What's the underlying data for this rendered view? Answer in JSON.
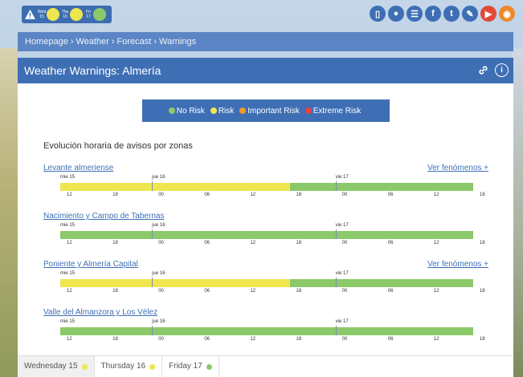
{
  "colors": {
    "no_risk": "#8cc96a",
    "risk": "#efe64f",
    "important_risk": "#f19a2b",
    "extreme_risk": "#e94040",
    "header_blue": "#3e6fb5",
    "breadcrumb_blue": "#5b85c4",
    "link": "#3e6fb5"
  },
  "forecast_mini": {
    "days": [
      {
        "label": "Wed 15",
        "line1": "Wed",
        "line2": "15",
        "level": "risk"
      },
      {
        "label": "Thu 16",
        "line1": "Thu",
        "line2": "16",
        "level": "risk"
      },
      {
        "label": "Fri 17",
        "line1": "Fri",
        "line2": "17",
        "level": "no_risk"
      }
    ]
  },
  "social_icons": [
    {
      "name": "mobile-icon",
      "glyph": "▯",
      "color": "#3e6fb5"
    },
    {
      "name": "android-icon",
      "glyph": "●",
      "color": "#3e6fb5"
    },
    {
      "name": "list-icon",
      "glyph": "☰",
      "color": "#3e6fb5"
    },
    {
      "name": "facebook-icon",
      "glyph": "f",
      "color": "#3e6fb5"
    },
    {
      "name": "twitter-icon",
      "glyph": "t",
      "color": "#3e6fb5"
    },
    {
      "name": "edit-icon",
      "glyph": "✎",
      "color": "#3e6fb5"
    },
    {
      "name": "youtube-icon",
      "glyph": "▶",
      "color": "#e04a3a"
    },
    {
      "name": "rss-icon",
      "glyph": "◉",
      "color": "#ec8a2a"
    }
  ],
  "breadcrumb": {
    "items": [
      "Homepage",
      "Weather",
      "Forecast",
      "Warnings"
    ],
    "separator": "›"
  },
  "panel": {
    "title": "Weather Warnings: Almería"
  },
  "legend": [
    {
      "label": "No Risk",
      "level": "no_risk"
    },
    {
      "label": "Risk",
      "level": "risk"
    },
    {
      "label": "Important Risk",
      "level": "important_risk"
    },
    {
      "label": "Extreme Risk",
      "level": "extreme_risk"
    }
  ],
  "section_title": "Evolución horaria de avisos por zonas",
  "timeline": {
    "day_labels": [
      "mie 15",
      "jue 16",
      "vie 17"
    ],
    "hour_labels": [
      "12",
      "18",
      "00",
      "06",
      "12",
      "18",
      "00",
      "06",
      "12",
      "18"
    ],
    "total_hours": 54
  },
  "zones": [
    {
      "name": "Levante almeriense",
      "link_label": "Ver fenómenos +",
      "segments": [
        {
          "from_hour": 0,
          "to_hour": 30,
          "level": "risk"
        },
        {
          "from_hour": 30,
          "to_hour": 54,
          "level": "no_risk"
        }
      ]
    },
    {
      "name": "Nacimiento y Campo de Tabernas",
      "link_label": "",
      "segments": [
        {
          "from_hour": 0,
          "to_hour": 54,
          "level": "no_risk"
        }
      ]
    },
    {
      "name": "Poniente y Almería Capital",
      "link_label": "Ver fenómenos +",
      "segments": [
        {
          "from_hour": 0,
          "to_hour": 30,
          "level": "risk"
        },
        {
          "from_hour": 30,
          "to_hour": 54,
          "level": "no_risk"
        }
      ]
    },
    {
      "name": "Valle del Almanzora y Los Vélez",
      "link_label": "",
      "segments": [
        {
          "from_hour": 0,
          "to_hour": 54,
          "level": "no_risk"
        }
      ]
    }
  ],
  "tabs": [
    {
      "label": "Wednesday 15",
      "level": "risk",
      "active": true
    },
    {
      "label": "Thursday 16",
      "level": "risk",
      "active": false
    },
    {
      "label": "Friday 17",
      "level": "no_risk",
      "active": false
    }
  ]
}
